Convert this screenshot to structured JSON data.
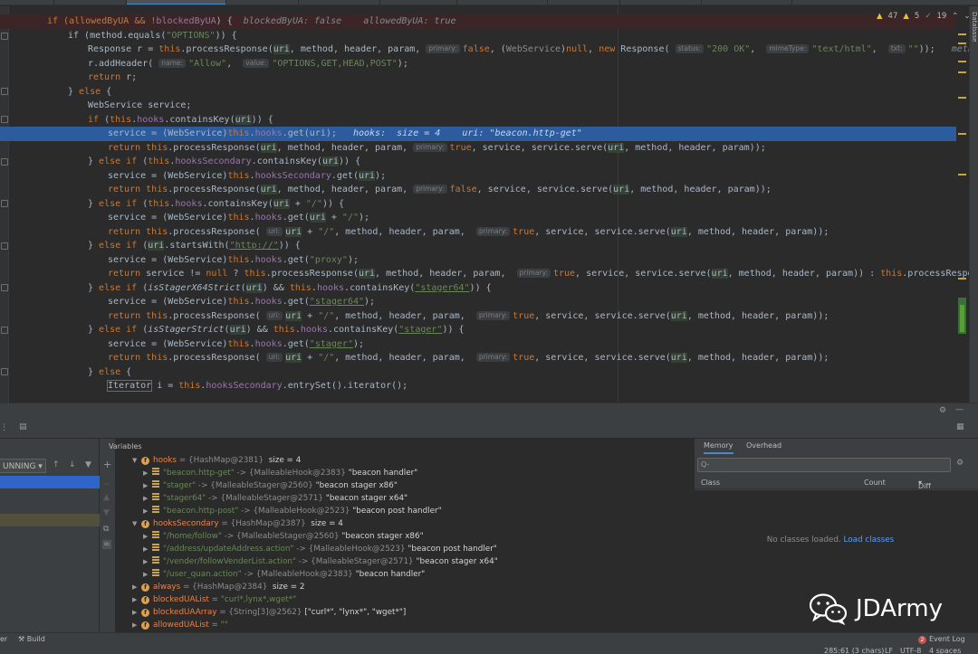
{
  "inspections": {
    "warnings": "47",
    "weak_warnings": "5",
    "ok": "19"
  },
  "side_tab": "Database",
  "code": {
    "l1": {
      "a": "if (allowedByUA && !",
      "b": "blockedByUA",
      "c": ") {",
      "d": "blockedByUA: false    allowedByUA: true"
    },
    "l2": {
      "a": "if (method.equals(",
      "b": "\"OPTIONS\"",
      "c": ")) {"
    },
    "l3": {
      "a": "Response r = ",
      "b": "this",
      "c": ".processResponse(",
      "d": "uri",
      "e": ", method, header, param, ",
      "h1": "primary:",
      "f": "false",
      "g": ", (",
      "h": "WebService",
      "i": ")",
      "j": "null",
      "k": ", ",
      "l": "new",
      "m": " Response( ",
      "h2": "status:",
      "n": "\"200 OK\"",
      "o": ",  ",
      "h3": "mimeType:",
      "p": "\"text/html\"",
      "q": ",  ",
      "h4": "txt:",
      "r": "\"\"",
      "s": "));   ",
      "t": "method: \"GET\""
    },
    "l4": {
      "a": "r.addHeader( ",
      "h1": "name:",
      "b": "\"Allow\"",
      "c": ",  ",
      "h2": "value:",
      "d": "\"OPTIONS,GET,HEAD,POST\"",
      "e": ");"
    },
    "l5": {
      "a": "return",
      "b": " r;"
    },
    "l6": {
      "a": "} ",
      "b": "else",
      "c": " {"
    },
    "l7": {
      "a": "WebService service;"
    },
    "l8": {
      "a": "if",
      "b": " (",
      "c": "this",
      "d": ".",
      "e": "hooks",
      "f": ".containsKey(",
      "g": "uri",
      "h": ")) {"
    },
    "l9": {
      "a": "service = (WebService)",
      "b": "this",
      "c": ".",
      "d": "hooks",
      "e": ".get(",
      "f": "uri",
      "g": ");   ",
      "h": "hooks:  size = 4    uri: \"beacon.http-get\""
    },
    "l10": {
      "a": "return",
      "b": " ",
      "c": "this",
      "d": ".processResponse(",
      "e": "uri",
      "f": ", method, header, param, ",
      "h1": "primary:",
      "g": "true",
      "h": ", service, service.serve(",
      "i": "uri",
      "j": ", method, header, param));"
    },
    "l11": {
      "a": "} ",
      "b": "else if",
      "c": " (",
      "d": "this",
      "e": ".",
      "f": "hooksSecondary",
      "g": ".containsKey(",
      "h": "uri",
      "i": ")) {"
    },
    "l12": {
      "a": "service = (WebService)",
      "b": "this",
      "c": ".",
      "d": "hooksSecondary",
      "e": ".get(",
      "f": "uri",
      "g": ");"
    },
    "l13": {
      "a": "return",
      "b": " ",
      "c": "this",
      "d": ".processResponse(",
      "e": "uri",
      "f": ", method, header, param, ",
      "h1": "primary:",
      "g": "false",
      "h": ", service, service.serve(",
      "i": "uri",
      "j": ", method, header, param));"
    },
    "l14": {
      "a": "} ",
      "b": "else if",
      "c": " (",
      "d": "this",
      "e": ".",
      "f": "hooks",
      "g": ".containsKey(",
      "h": "uri",
      "i": " + ",
      "j": "\"/\"",
      "k": ")) {"
    },
    "l15": {
      "a": "service = (WebService)",
      "b": "this",
      "c": ".",
      "d": "hooks",
      "e": ".get(",
      "f": "uri",
      "g": " + ",
      "h": "\"/\"",
      "i": ");"
    },
    "l16": {
      "a": "return",
      "b": " ",
      "c": "this",
      "d": ".processResponse( ",
      "h1": "uri:",
      "e": "uri",
      "f": " + ",
      "g": "\"/\"",
      "h": ", method, header, param,  ",
      "h2": "primary:",
      "i": "true",
      "j": ", service, service.serve(",
      "k": "uri",
      "l": ", method, header, param));"
    },
    "l17": {
      "a": "} ",
      "b": "else if",
      "c": " (",
      "d": "uri",
      "e": ".startsWith(",
      "f": "\"http://\"",
      "g": ")) {"
    },
    "l18": {
      "a": "service = (WebService)",
      "b": "this",
      "c": ".",
      "d": "hooks",
      "e": ".get(",
      "f": "\"proxy\"",
      "g": ");"
    },
    "l19": {
      "a": "return",
      "b": " service != ",
      "c": "null",
      "d": " ? ",
      "e": "this",
      "f": ".processResponse(",
      "g": "uri",
      "h": ", method, header, param,  ",
      "h1": "primary:",
      "i": "true",
      "j": ", service, service.serve(",
      "k": "uri",
      "l": ", method, header, param)) : ",
      "m": "this",
      "n": ".processResponse(",
      "o": "uri",
      "p": ", m"
    },
    "l20": {
      "a": "} ",
      "b": "else if",
      "c": " (",
      "d": "isStagerX64Strict",
      "e": "(",
      "f": "uri",
      "g": ") && ",
      "h": "this",
      "i": ".",
      "j": "hooks",
      "k": ".containsKey(",
      "l": "\"stager64\"",
      "m": ")) {"
    },
    "l21": {
      "a": "service = (WebService)",
      "b": "this",
      "c": ".",
      "d": "hooks",
      "e": ".get(",
      "f": "\"stager64\"",
      "g": ");"
    },
    "l22": {
      "a": "return",
      "b": " ",
      "c": "this",
      "d": ".processResponse( ",
      "h1": "uri:",
      "e": "uri",
      "f": " + ",
      "g": "\"/\"",
      "h": ", method, header, param,  ",
      "h2": "primary:",
      "i": "true",
      "j": ", service, service.serve(",
      "k": "uri",
      "l": ", method, header, param));"
    },
    "l23": {
      "a": "} ",
      "b": "else if",
      "c": " (",
      "d": "isStagerStrict",
      "e": "(",
      "f": "uri",
      "g": ") && ",
      "h": "this",
      "i": ".",
      "j": "hooks",
      "k": ".containsKey(",
      "l": "\"stager\"",
      "m": ")) {"
    },
    "l24": {
      "a": "service = (WebService)",
      "b": "this",
      "c": ".",
      "d": "hooks",
      "e": ".get(",
      "f": "\"stager\"",
      "g": ");"
    },
    "l25": {
      "a": "return",
      "b": " ",
      "c": "this",
      "d": ".processResponse( ",
      "h1": "uri:",
      "e": "uri",
      "f": " + ",
      "g": "\"/\"",
      "h": ", method, header, param,  ",
      "h2": "primary:",
      "i": "true",
      "j": ", service, service.serve(",
      "k": "uri",
      "l": ", method, header, param));"
    },
    "l26": {
      "a": "} ",
      "b": "else",
      "c": " {"
    },
    "l27": {
      "a": "Iterator",
      "b": " i = ",
      "c": "this",
      "d": ".",
      "e": "hooksSecondary",
      "f": ".entrySet().iterator();"
    }
  },
  "debugger": {
    "running": "UNNING",
    "variables_title": "Variables",
    "vars": [
      {
        "name": "hooks",
        "type": " = {HashMap@2381} ",
        "extra": " size = 4"
      },
      {
        "key": "\"beacon.http-get\"",
        "type": " -> {MalleableHook@2383} ",
        "val": "\"beacon handler\""
      },
      {
        "key": "\"stager\"",
        "type": " -> {MalleableStager@2560} ",
        "val": "\"beacon stager x86\""
      },
      {
        "key": "\"stager64\"",
        "type": " -> {MalleableStager@2571} ",
        "val": "\"beacon stager x64\""
      },
      {
        "key": "\"beacon.http-post\"",
        "type": " -> {MalleableHook@2523} ",
        "val": "\"beacon post handler\""
      },
      {
        "name": "hooksSecondary",
        "type": " = {HashMap@2387} ",
        "extra": " size = 4"
      },
      {
        "key": "\"/home/follow\"",
        "type": " -> {MalleableStager@2560} ",
        "val": "\"beacon stager x86\""
      },
      {
        "key": "\"/address/updateAddress.action\"",
        "type": " -> {MalleableHook@2523} ",
        "val": "\"beacon post handler\""
      },
      {
        "key": "\"/vender/followVenderList.action\"",
        "type": " -> {MalleableStager@2571} ",
        "val": "\"beacon stager x64\""
      },
      {
        "key": "\"/user_quan.action\"",
        "type": " -> {MalleableHook@2383} ",
        "val": "\"beacon handler\""
      },
      {
        "name": "always",
        "type": " = {HashMap@2384} ",
        "extra": " size = 2"
      },
      {
        "name": "blockedUAList",
        "type": " = ",
        "sval": "\"curl*,lynx*,wget*\""
      },
      {
        "name": "blockedUAArray",
        "type": " = {String[3]@2562} ",
        "extra": "[\"curl*\", \"lynx*\", \"wget*\"]"
      },
      {
        "name": "allowedUAList",
        "type": " = ",
        "sval": "\"\""
      }
    ]
  },
  "memory": {
    "tab_memory": "Memory",
    "tab_overhead": "Overhead",
    "search_placeholder": "Q-",
    "col_class": "Class",
    "col_count": "Count",
    "col_diff": "Diff",
    "empty_text": "No classes loaded.",
    "load_link": "Load classes"
  },
  "watermark": "JDArmy",
  "status": {
    "left_partial": "er",
    "build": "Build",
    "event_log": "Event Log",
    "event_count": "2",
    "position": "285:61 (3 chars)",
    "line_sep": "LF",
    "encoding": "UTF-8",
    "indent": "4 spaces"
  },
  "colors": {
    "selection": "#2d5c9e",
    "keyword": "#cc7832",
    "string": "#6a8759",
    "field": "#9876aa",
    "accent": "#4a88c7"
  }
}
